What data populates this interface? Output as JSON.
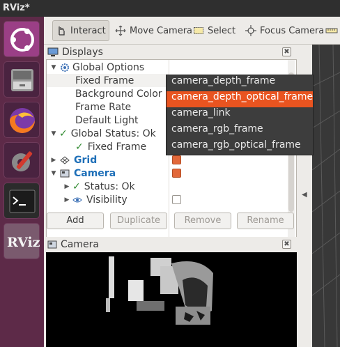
{
  "window": {
    "title": "RViz*"
  },
  "launcher": [
    {
      "name": "ubuntu-launcher-icon"
    },
    {
      "name": "files-icon"
    },
    {
      "name": "firefox-icon"
    },
    {
      "name": "settings-icon"
    },
    {
      "name": "terminal-icon"
    },
    {
      "name": "rviz-icon",
      "label": "RViz"
    }
  ],
  "toolbar": {
    "interact": "Interact",
    "move_camera": "Move Camera",
    "select": "Select",
    "focus_camera": "Focus Camera"
  },
  "displays": {
    "title": "Displays",
    "close": "✖",
    "rows": [
      {
        "label": "Global Options"
      },
      {
        "label": "Fixed Frame"
      },
      {
        "label": "Background Color"
      },
      {
        "label": "Frame Rate"
      },
      {
        "label": "Default Light"
      },
      {
        "label": "Global Status: Ok"
      },
      {
        "label": "Fixed Frame"
      },
      {
        "label": "Grid",
        "checked": true
      },
      {
        "label": "Camera",
        "checked": true
      },
      {
        "label": "Status: Ok"
      },
      {
        "label": "Visibility",
        "checked": false
      }
    ],
    "buttons": {
      "add": "Add",
      "duplicate": "Duplicate",
      "remove": "Remove",
      "rename": "Rename"
    }
  },
  "frame_dropdown": {
    "options": [
      "camera_depth_frame",
      "camera_depth_optical_frame",
      "camera_link",
      "camera_rgb_frame",
      "camera_rgb_optical_frame"
    ],
    "highlighted": "camera_depth_optical_frame"
  },
  "camera_panel": {
    "title": "Camera",
    "close": "✖"
  },
  "colors": {
    "accent": "#e95420",
    "checkbox_on": "#e2683a",
    "launcher": "#5d2a48"
  }
}
